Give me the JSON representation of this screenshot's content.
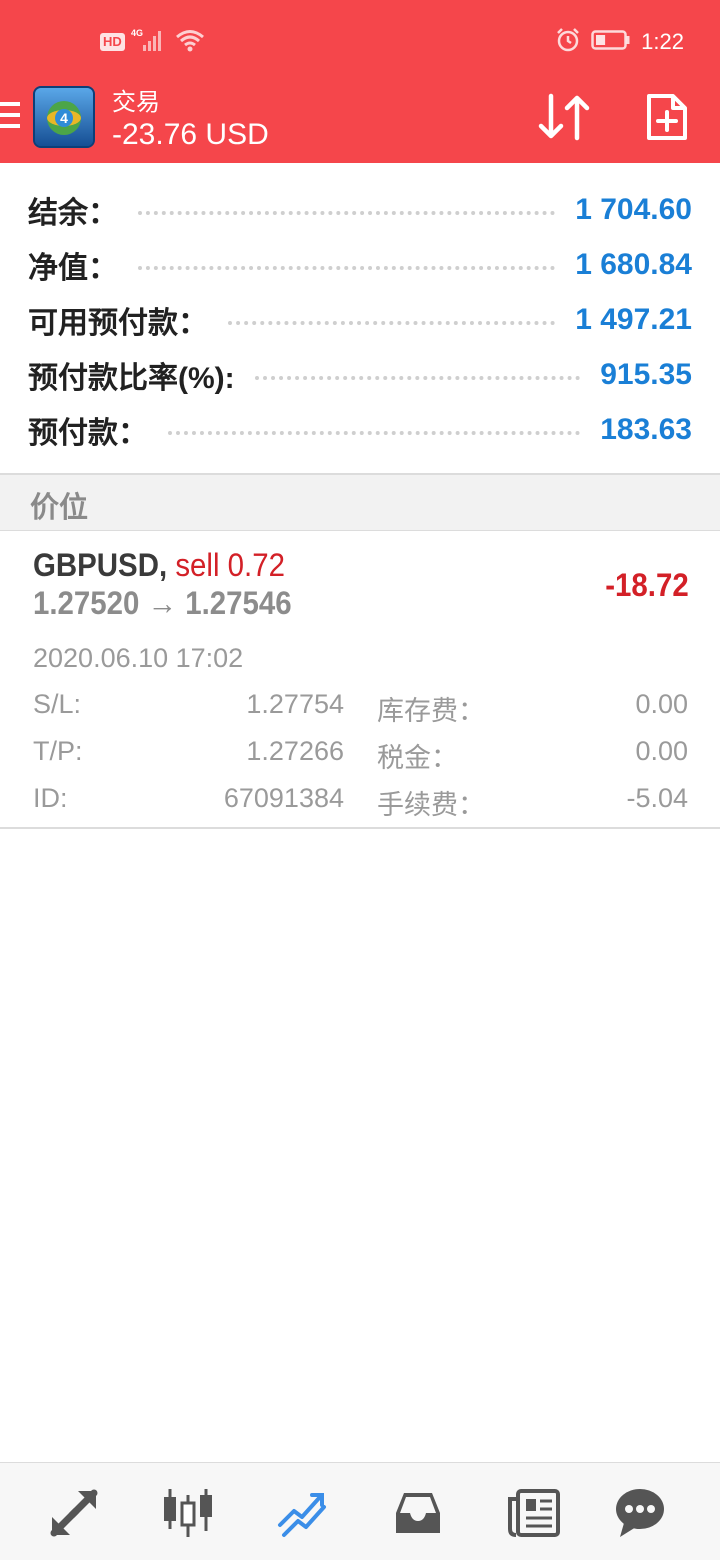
{
  "status_bar": {
    "network_badge": "HD",
    "network_type": "4G",
    "time": "1:22",
    "battery_level": 0.35
  },
  "header": {
    "title": "交易",
    "profit": "-23.76 USD",
    "icons": [
      "menu-icon",
      "mt4-logo",
      "sort-arrows-icon",
      "new-order-icon"
    ]
  },
  "account": {
    "rows": [
      {
        "label": "结余：",
        "value": "1 704.60"
      },
      {
        "label": "净值：",
        "value": "1 680.84"
      },
      {
        "label": "可用预付款：",
        "value": "1 497.21"
      },
      {
        "label": "预付款比率(%):",
        "value": "915.35"
      },
      {
        "label": "预付款：",
        "value": "183.63"
      }
    ]
  },
  "positions_header": "价位",
  "position": {
    "symbol": "GBPUSD,",
    "side_volume": "sell 0.72",
    "open_price": "1.27520",
    "arrow": "→",
    "current_price": "1.27546",
    "profit": "-18.72",
    "open_time": "2020.06.10 17:02",
    "details": {
      "sl_label": "S/L:",
      "sl_value": "1.27754",
      "tp_label": "T/P:",
      "tp_value": "1.27266",
      "id_label": "ID:",
      "id_value": "67091384",
      "swap_label": "库存费：",
      "swap_value": "0.00",
      "taxes_label": "税金：",
      "taxes_value": "0.00",
      "commission_label": "手续费：",
      "commission_value": "-5.04"
    }
  },
  "bottom_nav": {
    "items": [
      "quotes-icon",
      "chart-icon",
      "trade-icon",
      "history-icon",
      "news-icon",
      "messages-icon"
    ],
    "active_item": "trade-icon"
  },
  "colors": {
    "header_bg": "#f5464b",
    "value_blue": "#1a7fd6",
    "loss_red": "#d32027",
    "nav_active": "#3b8ee8"
  }
}
